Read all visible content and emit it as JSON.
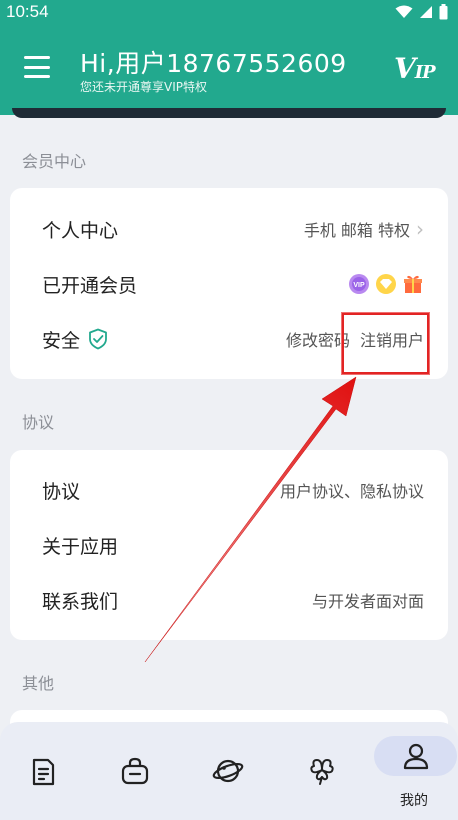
{
  "status_bar": {
    "time": "10:54"
  },
  "header": {
    "greeting": "Hi,用户18767552609",
    "subtitle": "您还未开通尊享VIP特权",
    "vip_logo": "VIP"
  },
  "sections": {
    "member": {
      "label": "会员中心",
      "rows": {
        "profile": {
          "title": "个人中心",
          "detail": "手机 邮箱 特权"
        },
        "membership": {
          "title": "已开通会员"
        },
        "security": {
          "title": "安全",
          "change_password": "修改密码",
          "delete_account": "注销用户"
        }
      }
    },
    "agreement": {
      "label": "协议",
      "rows": {
        "agreement": {
          "title": "协议",
          "detail": "用户协议、隐私协议"
        },
        "about": {
          "title": "关于应用"
        },
        "contact": {
          "title": "联系我们",
          "detail": "与开发者面对面"
        }
      }
    },
    "other": {
      "label": "其他"
    }
  },
  "bottom_nav": {
    "active_label": "我的",
    "items": [
      "document-icon",
      "bag-icon",
      "planet-icon",
      "clover-icon",
      "profile-icon"
    ]
  },
  "colors": {
    "brand": "#22a98e",
    "highlight": "#e22424",
    "accent_badge": "#ff6a3d"
  }
}
